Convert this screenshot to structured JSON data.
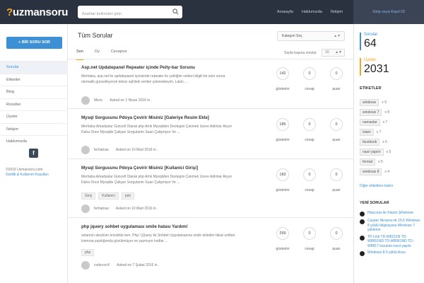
{
  "header": {
    "logo_accent": "?",
    "logo_text": "uzmansoru",
    "search_placeholder": "Anahtar kelimeleri girin",
    "nav": [
      "Anasayfa",
      "Hakkımızda",
      "İletişim"
    ],
    "login": "Giriş veya Kayıt Ol"
  },
  "leftbar": {
    "ask_button": "+ BİR SORU SOR",
    "nav": [
      "Sorular",
      "Etiketler",
      "Blog",
      "Rozetler",
      "Üyeler",
      "İletişim",
      "Hakkımızda"
    ],
    "social_icon": "f",
    "copyright": "©2016 Uzmansoru.com",
    "footer_link": "Gizlilik & Kullanım Koşulları"
  },
  "main": {
    "title": "Tüm Sorular",
    "category_select": "Kategori Seç",
    "tabs": [
      "Son",
      "Oy",
      "Cevapsız"
    ],
    "perpage_label": "Sayfa başına sorular",
    "perpage_value": "10",
    "stat_labels": [
      "gösterim",
      "cevap",
      "puan"
    ],
    "questions": [
      {
        "title": "Asp.net Updatepanel Repeater içinde Peity-bar Sorunu",
        "excerpt": "Merhaba, asp.net ile updatepanel içerisinde repeater ile çektiğim verileri bilgili bir süre sonra otomatik güncelleyerek tekrar sql'deki verileri çekmekteyim. Lakin ...",
        "tags": [],
        "user": "Meric",
        "date": "Asked on 1 Nisan 2016 in .",
        "views": "142",
        "answers": "0",
        "points": "0"
      },
      {
        "title": "Mysql Sorgusunu Pdoya Çevirir Misiniz [Galeriye Resim Ekle]",
        "excerpt": "Merhaba Arkadaslar Güncell Olarak php Artık Mysqliden Destegini Çekmek Uzere Adimlar Atıyor Daha Once Mysqlde Çalişan Sorgularim Suan Çalişmiyor Ve ...",
        "tags": [],
        "user": "ferhatnas",
        "date": "Asked on 10 Mart 2016 in .",
        "views": "185",
        "answers": "0",
        "points": "0"
      },
      {
        "title": "Mysql Sorgusunu Pdoya Çevirir Misiniz [Kullanici Girişi]",
        "excerpt": "Merhaba Arkadaslar Güncell Olarak php Artık Mysqliden Destegini Çekmek Uzere Adimlar Atıyor Daha Once Mysqlde Çalişan Sorgularim Suan Çalişmiyor Ve ...",
        "tags": [
          "Giriş",
          "Kullanici",
          "pdo"
        ],
        "user": "ferhatnas",
        "date": "Asked on 10 Mart 2016 in .",
        "views": "183",
        "answers": "0",
        "points": "0"
      },
      {
        "title": "php jquery sohbet uygulaması smile hatası Yardım!",
        "excerpt": "selamün aleyküm öncelikle ben .Php / jQuery ile Sohbet Uygulamasına smile ekledim fakat sohbet kısmına yazdığımda gözükmüyor ve yazmıyor kodlar ...",
        "tags": [
          "php"
        ],
        "user": "codeconX",
        "date": "Asked on 7 Şubat 2016 in .",
        "views": "269",
        "answers": "0",
        "points": "0"
      }
    ]
  },
  "rightbar": {
    "questions_label": "Sorular",
    "questions_count": "64",
    "members_label": "Üyeler",
    "members_count": "2031",
    "tags_heading": "ETİKETLER",
    "tags": [
      {
        "name": "windows",
        "count": "x 9"
      },
      {
        "name": "windows 7",
        "count": "x 8"
      },
      {
        "name": "namazlar",
        "count": "x 7"
      },
      {
        "name": "islam",
        "count": "x 7"
      },
      {
        "name": "facebook",
        "count": "x 6"
      },
      {
        "name": "nasıl yapılır",
        "count": "x 5"
      },
      {
        "name": "format",
        "count": "x 5"
      },
      {
        "name": "windows 8",
        "count": "x 4"
      }
    ],
    "more_tags": "Diğer etiketlere bakın",
    "recent_heading": "YENİ SORULAR",
    "recent": [
      "Htaccess ile Klasör Şifreleme",
      "Casper Nirvana nb 15.6 Windows 8 yüklü bilgisayara Windows 7 yükleme",
      "TP-Link TD-W8151N TD-W8951ND TD-W8961ND TD-W8817 kurulum nasıl yapılır",
      "Windows 8.9 yüklü Asus"
    ]
  }
}
